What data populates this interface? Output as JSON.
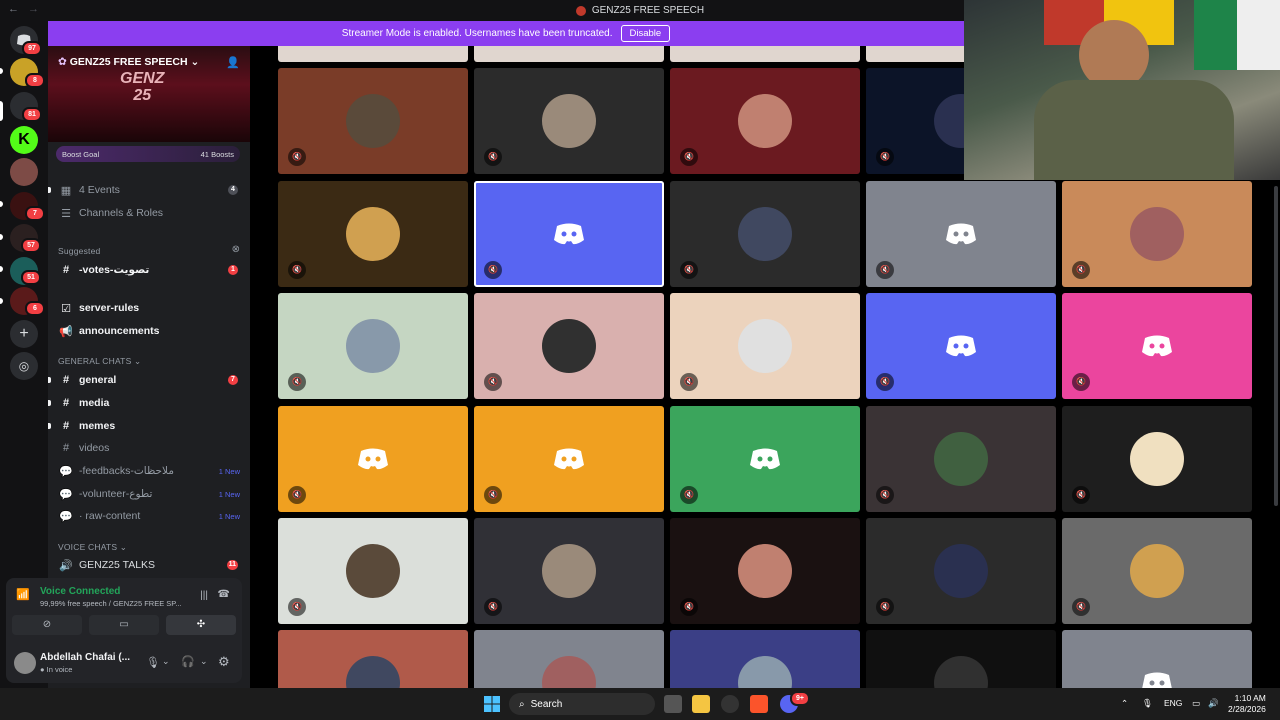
{
  "window": {
    "title": "GENZ25 FREE SPEECH"
  },
  "banner": {
    "text": "Streamer Mode is enabled. Usernames have been truncated.",
    "button": "Disable"
  },
  "guilds": {
    "badges": [
      "97",
      "8",
      "81",
      "7",
      "57",
      "51",
      "6"
    ]
  },
  "server": {
    "name": "GENZ25 FREE SPEECH",
    "banner_logo": "GENZ\n25",
    "boost_goal": "Boost Goal",
    "boost_count": "41 Boosts"
  },
  "sidebar": {
    "events": "4 Events",
    "events_count": "4",
    "channels_roles": "Channels & Roles",
    "suggested_label": "Suggested",
    "suggested_channel": "-votes-تصويت",
    "suggested_count": "1",
    "server_rules": "server-rules",
    "announcements": "announcements",
    "cat_general": "GENERAL CHATS",
    "general": "general",
    "general_count": "7",
    "media": "media",
    "memes": "memes",
    "videos": "videos",
    "feedbacks": "-feedbacks-ملاحظات",
    "volunteer": "-volunteer-تطوع",
    "raw_content": "· raw-content",
    "new_tag": "1 New",
    "cat_voice": "VOICE CHATS",
    "voice_channel": "GENZ25 TALKS",
    "voice_count": "11"
  },
  "voice": {
    "status": "Voice Connected",
    "sub": "99,99% free speech / GENZ25 FREE SP..."
  },
  "user": {
    "name": "Abdellah Chafai (...",
    "status": "In voice"
  },
  "grid": {
    "colors": {
      "r0": [
        "#7a3c28",
        "#2b2b2b",
        "#6b1a20",
        "#0c1428"
      ],
      "r1": [
        "#3b2a14",
        "#5865f2",
        "#2b2b2b",
        "#80848e",
        "#c98a5a"
      ],
      "r2": [
        "#c5d6c2",
        "#d9b0ae",
        "#ecd3bd",
        "#5865f2",
        "#eb459e"
      ],
      "r3": [
        "#f0a020",
        "#f0a020",
        "#3ba55c",
        "#3a3335",
        "#1e1e1e"
      ],
      "r4": [
        "#dbdfda",
        "#303036",
        "#1a1111",
        "#2b2b2b",
        "#6a6a6a"
      ],
      "r5": [
        "#b05a4a",
        "#80848e",
        "#3b3f86",
        "#101010",
        "#80848e"
      ]
    }
  },
  "taskbar": {
    "search": "Search",
    "lang": "ENG",
    "time": "1:10 AM",
    "date": "2/28/2026",
    "discord_badge": "9+"
  }
}
